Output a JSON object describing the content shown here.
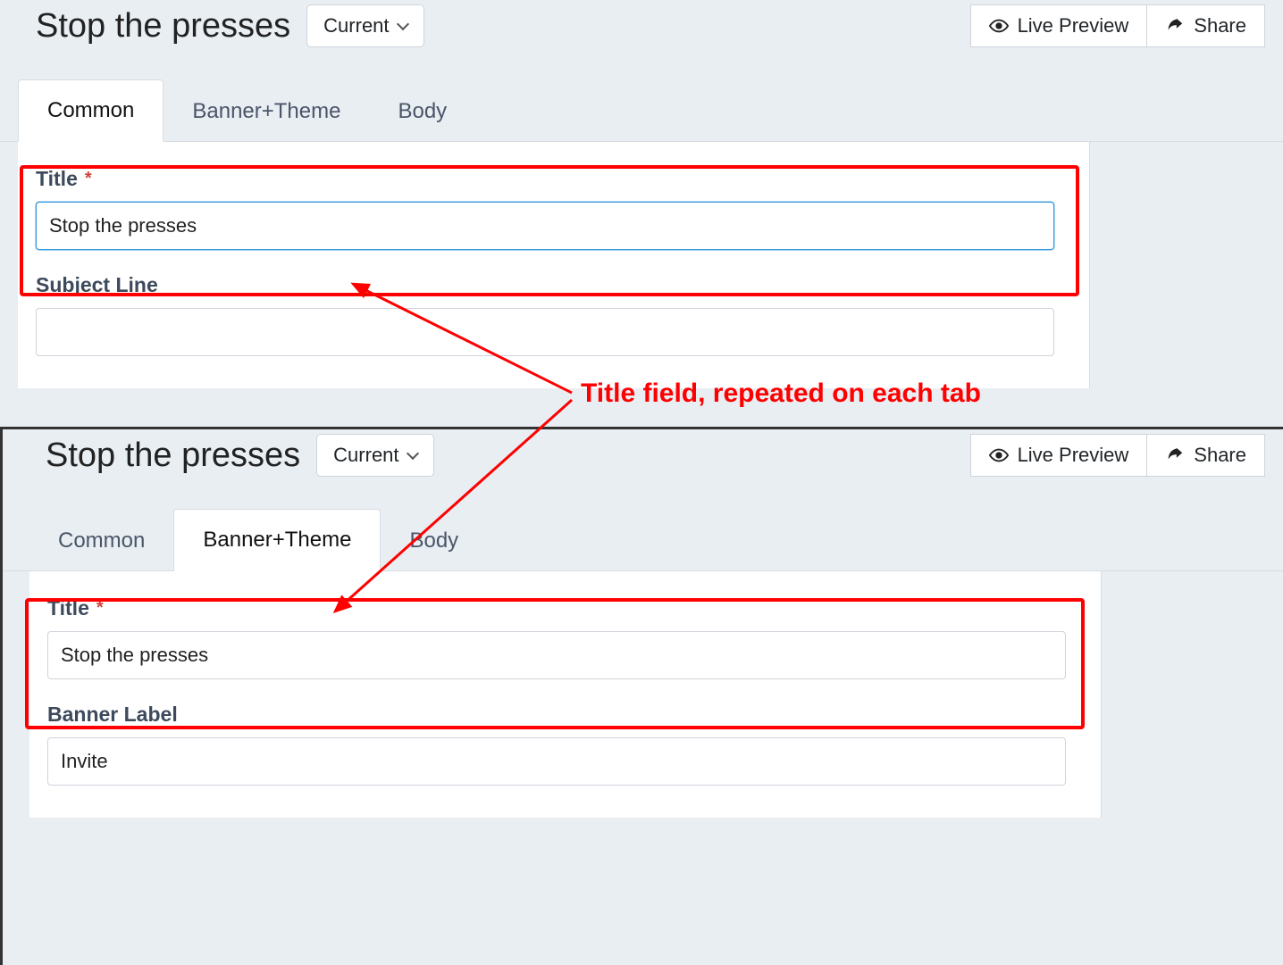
{
  "annotation": {
    "text": "Title field, repeated on each tab"
  },
  "shot1": {
    "header": {
      "title": "Stop the presses",
      "versionDropdown": "Current",
      "livePreview": "Live Preview",
      "share": "Share"
    },
    "tabs": {
      "common": "Common",
      "bannerTheme": "Banner+Theme",
      "body": "Body",
      "active": "common"
    },
    "fields": {
      "titleLabel": "Title",
      "titleValue": "Stop the presses",
      "subjectLabel": "Subject Line",
      "subjectValue": ""
    }
  },
  "shot2": {
    "header": {
      "title": "Stop the presses",
      "versionDropdown": "Current",
      "livePreview": "Live Preview",
      "share": "Share"
    },
    "tabs": {
      "common": "Common",
      "bannerTheme": "Banner+Theme",
      "body": "Body",
      "active": "bannerTheme"
    },
    "fields": {
      "titleLabel": "Title",
      "titleValue": "Stop the presses",
      "bannerLabel": "Banner Label",
      "bannerValue": "Invite"
    }
  }
}
